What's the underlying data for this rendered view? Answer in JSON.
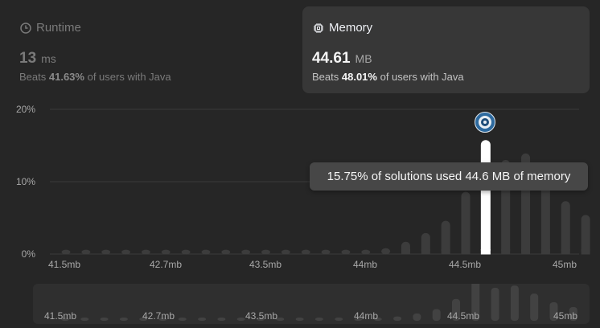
{
  "runtime": {
    "title": "Runtime",
    "icon": "clock-icon",
    "value": "13",
    "unit": "ms",
    "beats_prefix": "Beats",
    "beats_pct": "41.63%",
    "beats_suffix": "of users with Java"
  },
  "memory": {
    "title": "Memory",
    "icon": "chip-icon",
    "value": "44.61",
    "unit": "MB",
    "beats_prefix": "Beats",
    "beats_pct": "48.01%",
    "beats_suffix": "of users with Java"
  },
  "tooltip": "15.75% of solutions used 44.6 MB of memory",
  "colors": {
    "background": "#262626",
    "bar": "#3c3c3c",
    "highlight_bar": "#ffffff",
    "tooltip_bg": "#474747"
  },
  "chart_data": {
    "type": "bar",
    "yticks": [
      "0%",
      "10%",
      "20%"
    ],
    "ylim": [
      0,
      20
    ],
    "xticks": [
      "41.5mb",
      "42.7mb",
      "43.5mb",
      "44mb",
      "44.5mb",
      "45mb"
    ],
    "highlight_index": 21,
    "values": [
      0.6,
      0.6,
      0.6,
      0.6,
      0.6,
      0.6,
      0.6,
      0.6,
      0.6,
      0.6,
      0.6,
      0.6,
      0.6,
      0.6,
      0.6,
      0.6,
      0.8,
      1.7,
      2.9,
      4.6,
      8.6,
      15.75,
      13.0,
      13.9,
      10.7,
      7.3,
      5.4
    ]
  },
  "minimap": {
    "xticks": [
      "41.5mb",
      "42.7mb",
      "43.5mb",
      "44mb",
      "44.5mb",
      "45mb"
    ]
  }
}
